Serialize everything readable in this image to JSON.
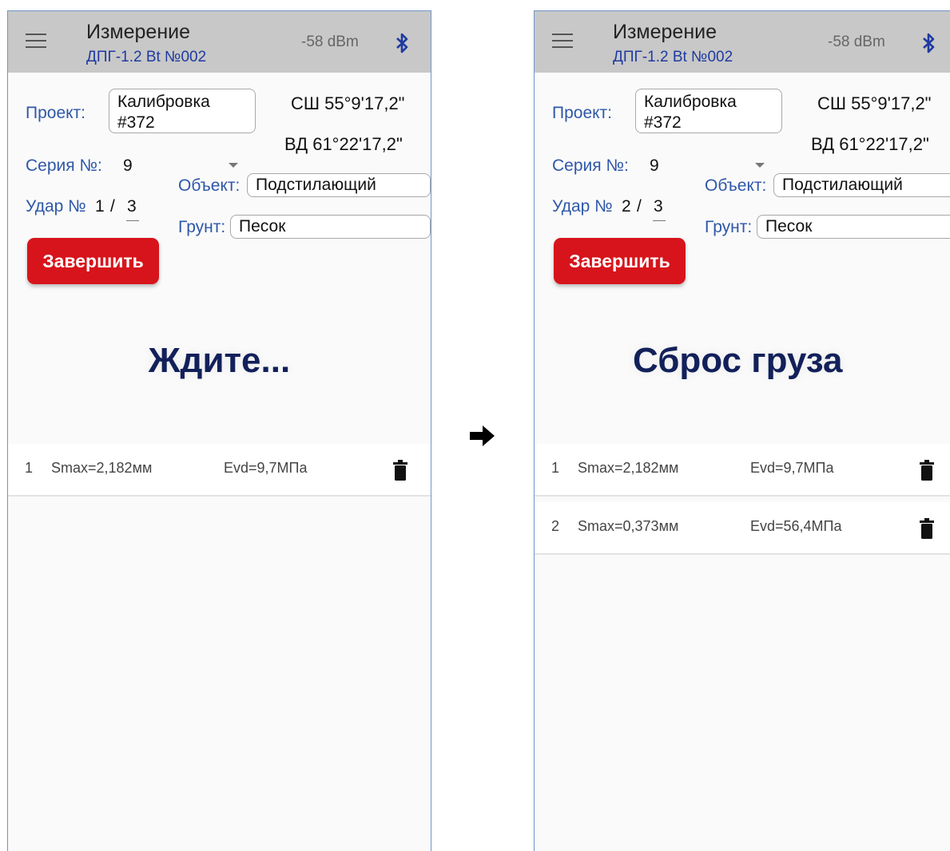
{
  "screens": [
    {
      "header": {
        "title": "Измерение",
        "subtitle": "ДПГ-1.2 Bt №002",
        "signal": "-58 dBm"
      },
      "project_label": "Проект:",
      "project_value": "Калибровка\n#372",
      "lat": "СШ 55°9'17,2\"",
      "lon": "ВД 61°22'17,2\"",
      "series_label": "Серия №:",
      "series_value": "9",
      "object_label": "Объект:",
      "object_value": "Подстилающий",
      "impact_label": "Удар №",
      "impact_current": "1",
      "impact_sep": "/",
      "impact_total": "3",
      "ground_label": "Грунт:",
      "ground_value": "Песок",
      "finish_button": "Завершить",
      "status": "Ждите...",
      "results": [
        {
          "num": "1",
          "smax": "Smax=2,182мм",
          "evd": "Evd=9,7МПа"
        }
      ]
    },
    {
      "header": {
        "title": "Измерение",
        "subtitle": "ДПГ-1.2 Bt №002",
        "signal": "-58 dBm"
      },
      "project_label": "Проект:",
      "project_value": "Калибровка\n#372",
      "lat": "СШ 55°9'17,2\"",
      "lon": "ВД 61°22'17,2\"",
      "series_label": "Серия №:",
      "series_value": "9",
      "object_label": "Объект:",
      "object_value": "Подстилающий",
      "impact_label": "Удар №",
      "impact_current": "2",
      "impact_sep": "/",
      "impact_total": "3",
      "ground_label": "Грунт:",
      "ground_value": "Песок",
      "finish_button": "Завершить",
      "status": "Сброс груза",
      "results": [
        {
          "num": "1",
          "smax": "Smax=2,182мм",
          "evd": "Evd=9,7МПа"
        },
        {
          "num": "2",
          "smax": "Smax=0,373мм",
          "evd": "Evd=56,4МПа"
        }
      ]
    }
  ],
  "icons": {
    "menu": "hamburger-icon",
    "bluetooth": "bluetooth-icon",
    "delete": "trash-icon",
    "transition": "arrow-right-icon"
  },
  "colors": {
    "accent": "#2f57a8",
    "button": "#d7141b",
    "status_text": "#12205a",
    "bluetooth": "#1f3aa0"
  }
}
